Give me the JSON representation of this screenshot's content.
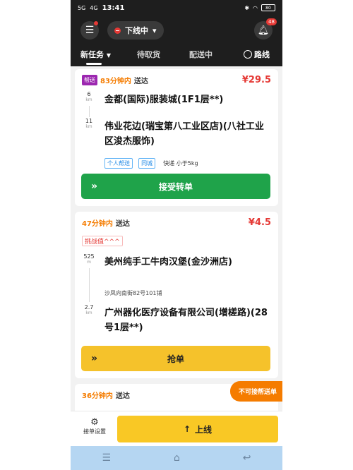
{
  "status_bar": {
    "signal1": "5G",
    "signal2": "4G",
    "time": "13:41",
    "battery": "80"
  },
  "header": {
    "status_label": "下线中",
    "notification_count": "48",
    "tabs": [
      "新任务",
      "待取货",
      "配送中"
    ],
    "route_label": "路线"
  },
  "orders": [
    {
      "tag": "帮送",
      "eta": "83分钟内",
      "eta_suffix": "送达",
      "price": "¥29.5",
      "pickup_distance": "6",
      "pickup_distance_unit": "km",
      "pickup": "金都(国际)服装城(1F1层**)",
      "dropoff_distance": "11",
      "dropoff_distance_unit": "km",
      "dropoff": "伟业花边(瑞宝第八工业区店)(八社工业区浚杰服饰)",
      "chips": [
        "个人帮送",
        "同城",
        "快递 小于5kg"
      ],
      "action": "接受转单"
    },
    {
      "eta": "47分钟内",
      "eta_suffix": "送达",
      "price": "¥4.5",
      "challenge": "挑战值^^^",
      "pickup_distance": "525",
      "pickup_distance_unit": "m",
      "pickup": "美州纯手工牛肉汉堡(金沙洲店)",
      "pickup_sub": "沙凤向南街82号101铺",
      "dropoff_distance": "2.7",
      "dropoff_distance_unit": "km",
      "dropoff": "广州器化医疗设备有限公司(增槎路)(28号1层**)",
      "action": "抢单"
    },
    {
      "eta": "36分钟内",
      "eta_suffix": "送达"
    }
  ],
  "float_tag": "不可接帮送单",
  "bottom": {
    "settings_label": "接单设置",
    "online_label": "上线"
  },
  "colors": {
    "accent_yellow": "#f9c825",
    "accent_green": "#1fa34a",
    "price_red": "#e53935",
    "eta_orange": "#f57c00"
  }
}
